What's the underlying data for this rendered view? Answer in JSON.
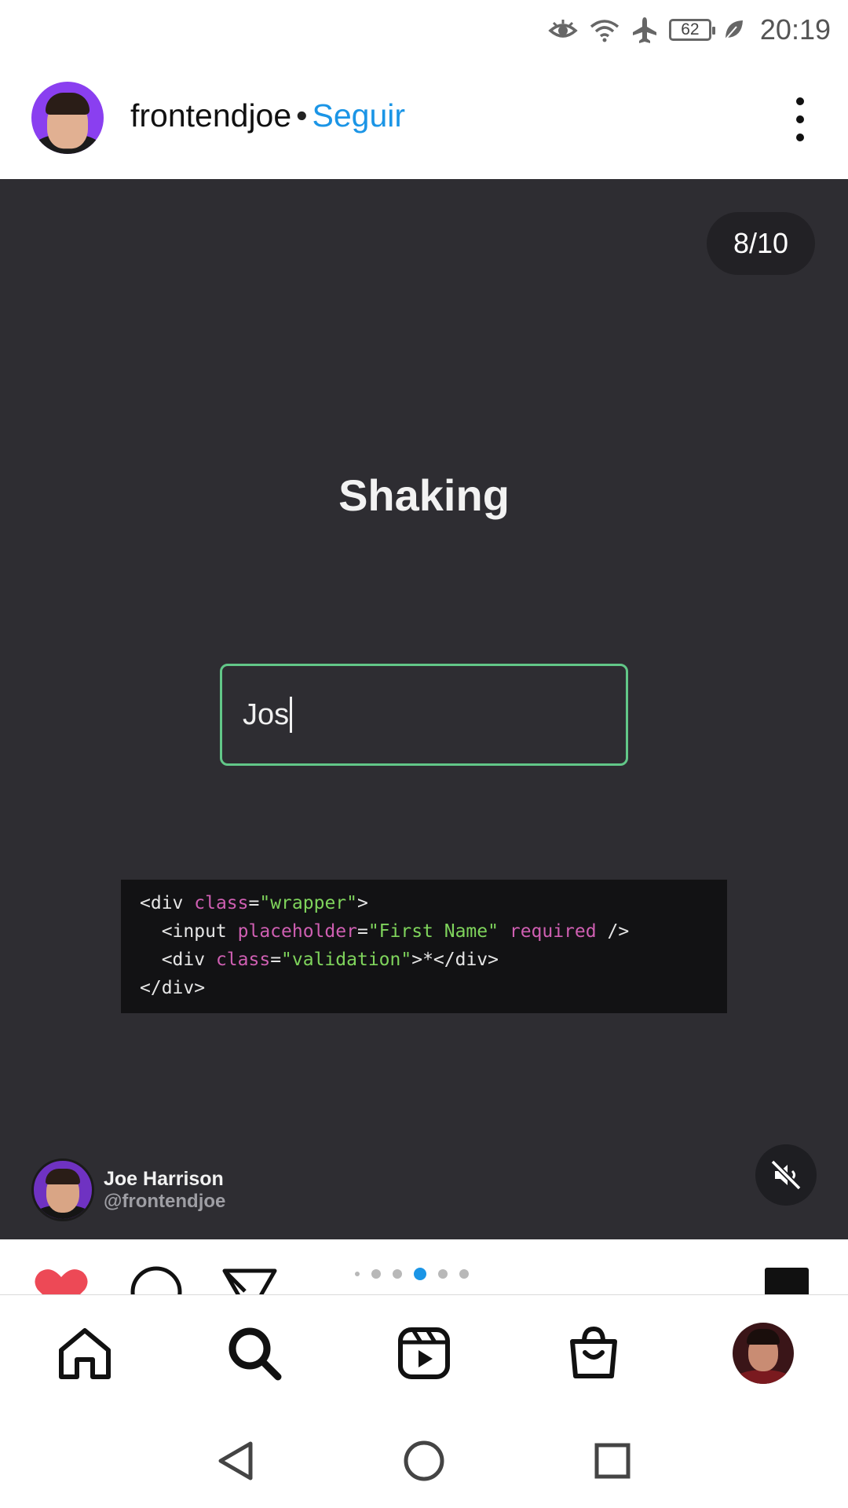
{
  "status_bar": {
    "battery_level": "62",
    "time": "20:19",
    "icons": [
      "eye-icon",
      "wifi-icon",
      "airplane-icon",
      "battery-icon",
      "leaf-icon"
    ]
  },
  "post": {
    "username": "frontendjoe",
    "separator": "•",
    "follow_label": "Seguir"
  },
  "media": {
    "page_counter": "8/10",
    "title": "Shaking",
    "input_value": "Jos",
    "code_lines": [
      [
        [
          "tag",
          "<div "
        ],
        [
          "attr",
          "class"
        ],
        [
          "tag",
          "="
        ],
        [
          "str",
          "\"wrapper\""
        ],
        [
          "tag",
          ">"
        ]
      ],
      [
        [
          "tag",
          "  <input "
        ],
        [
          "attr",
          "placeholder"
        ],
        [
          "tag",
          "="
        ],
        [
          "str",
          "\"First Name\""
        ],
        [
          "tag",
          " "
        ],
        [
          "attr",
          "required"
        ],
        [
          "tag",
          " />"
        ]
      ],
      [
        [
          "tag",
          "  <div "
        ],
        [
          "attr",
          "class"
        ],
        [
          "tag",
          "="
        ],
        [
          "str",
          "\"validation\""
        ],
        [
          "tag",
          ">*</div>"
        ]
      ],
      [
        [
          "tag",
          "</div>"
        ]
      ]
    ],
    "author_name": "Joe Harrison",
    "author_handle": "@frontendjoe"
  },
  "carousel": {
    "total_dots": 6,
    "active_index": 3
  },
  "colors": {
    "accent_blue": "#1b95e6",
    "like_red": "#ed4956",
    "input_border_green": "#62c788",
    "media_bg": "#2e2d32"
  }
}
